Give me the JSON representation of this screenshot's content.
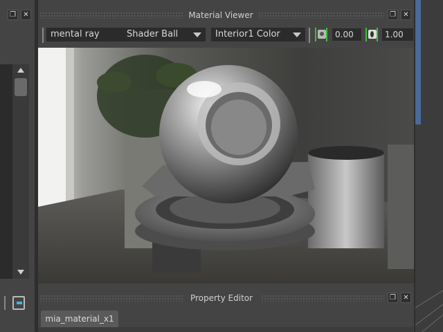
{
  "material_viewer": {
    "title": "Material Viewer",
    "renderer": "mental ray",
    "shape": "Shader Ball",
    "environment": "Interior1 Color",
    "exposure_value": "0.00",
    "gamma_value": "1.00"
  },
  "property_editor": {
    "title": "Property Editor",
    "tab_label": "mia_material_x1"
  },
  "colors": {
    "accent_green": "#38c238",
    "panel_bg": "#444444",
    "field_bg": "#2b2b2b"
  },
  "icons": {
    "float": "float-window-icon",
    "close": "close-icon",
    "exposure": "exposure-icon",
    "gamma": "gamma-icon"
  }
}
